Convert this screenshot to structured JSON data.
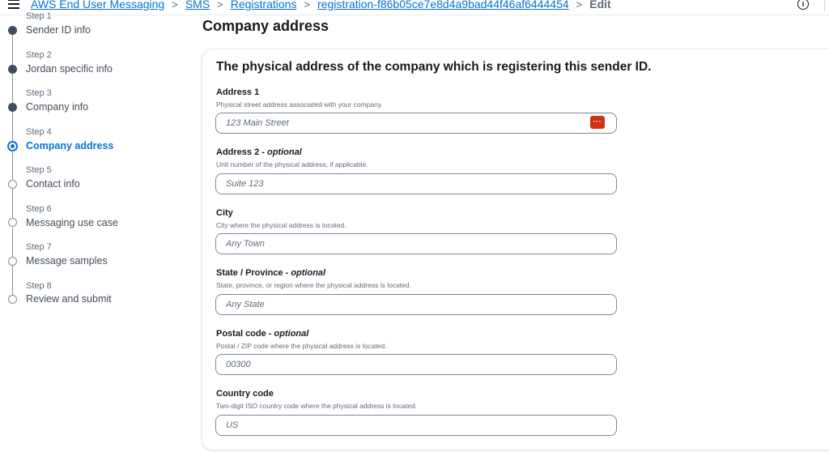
{
  "breadcrumb": {
    "items": [
      "AWS End User Messaging",
      "SMS",
      "Registrations",
      "registration-f86b05ce7e8d4a9bad44f46af6444454"
    ],
    "current": "Edit"
  },
  "steps": [
    {
      "num": "Step 1",
      "title": "Sender ID info",
      "state": "done"
    },
    {
      "num": "Step 2",
      "title": "Jordan specific info",
      "state": "done"
    },
    {
      "num": "Step 3",
      "title": "Company info",
      "state": "done"
    },
    {
      "num": "Step 4",
      "title": "Company address",
      "state": "current"
    },
    {
      "num": "Step 5",
      "title": "Contact info",
      "state": "todo"
    },
    {
      "num": "Step 6",
      "title": "Messaging use case",
      "state": "todo"
    },
    {
      "num": "Step 7",
      "title": "Message samples",
      "state": "todo"
    },
    {
      "num": "Step 8",
      "title": "Review and submit",
      "state": "todo"
    }
  ],
  "page_title": "Company address",
  "container_header": "The physical address of the company which is registering this sender ID.",
  "fields": [
    {
      "label": "Address 1",
      "optional": "",
      "description": "Physical street address associated with your company.",
      "placeholder": "123 Main Street"
    },
    {
      "label": "Address 2 - ",
      "optional": "optional",
      "description": "Unit number of the physical address, if applicable.",
      "placeholder": "Suite 123"
    },
    {
      "label": "City",
      "optional": "",
      "description": "City where the physical address is located.",
      "placeholder": "Any Town"
    },
    {
      "label": "State / Province - ",
      "optional": "optional",
      "description": "State, province, or region where the physical address is located.",
      "placeholder": "Any State"
    },
    {
      "label": "Postal code - ",
      "optional": "optional",
      "description": "Postal / ZIP code where the physical address is located.",
      "placeholder": "00300"
    },
    {
      "label": "Country code",
      "optional": "",
      "description": "Two-digit ISO country code where the physical address is located.",
      "placeholder": "US"
    }
  ],
  "password_manager_icon": "···",
  "info_icon": "i",
  "colors": {
    "link": "#0972d3",
    "current_step": "#0972d3",
    "password_badge": "#d13212"
  }
}
